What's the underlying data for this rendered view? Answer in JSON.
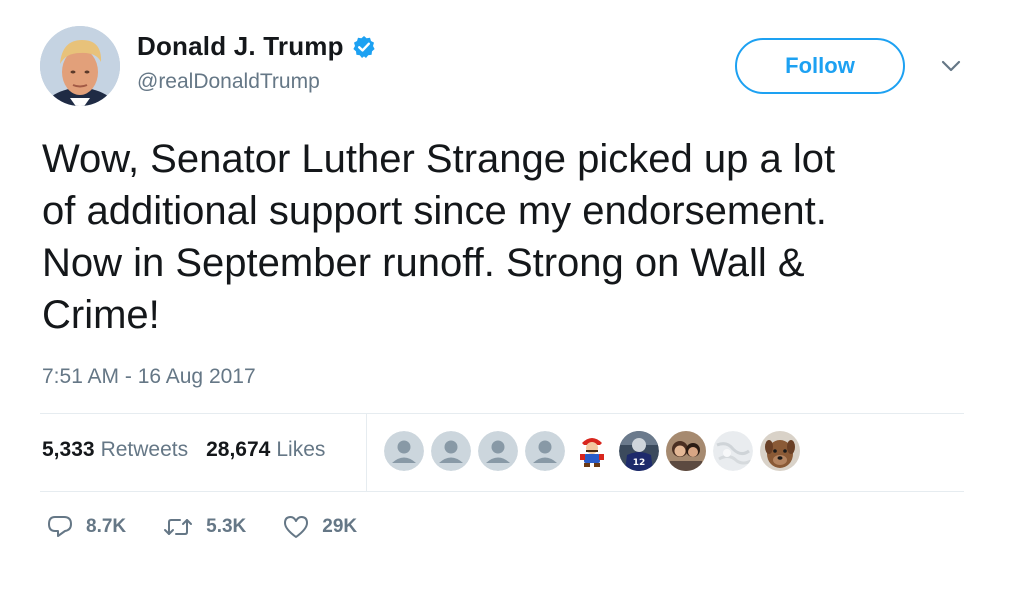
{
  "user": {
    "display_name": "Donald J. Trump",
    "handle": "@realDonaldTrump",
    "verified": true,
    "avatar_icon": "profile-photo"
  },
  "follow_button": {
    "label": "Follow"
  },
  "menu_icon": "chevron-down-icon",
  "tweet": {
    "text": "Wow, Senator Luther Strange picked up a lot\nof additional support since my endorsement.\nNow in September runoff. Strong on Wall &\nCrime!",
    "timestamp": "7:51 AM - 16 Aug 2017"
  },
  "stats": {
    "retweets_count": "5,333",
    "retweets_label": "Retweets",
    "likes_count": "28,674",
    "likes_label": "Likes"
  },
  "likers": [
    {
      "kind": "default-avatar"
    },
    {
      "kind": "default-avatar"
    },
    {
      "kind": "default-avatar"
    },
    {
      "kind": "default-avatar"
    },
    {
      "kind": "mario-avatar"
    },
    {
      "kind": "football-player-avatar"
    },
    {
      "kind": "couple-photo-avatar"
    },
    {
      "kind": "white-texture-avatar"
    },
    {
      "kind": "dog-avatar"
    }
  ],
  "actions": {
    "reply_count": "8.7K",
    "retweet_count": "5.3K",
    "like_count": "29K"
  },
  "colors": {
    "accent": "#1da1f2",
    "text": "#14171a",
    "secondary": "#657786",
    "divider": "#e6ecf0"
  }
}
